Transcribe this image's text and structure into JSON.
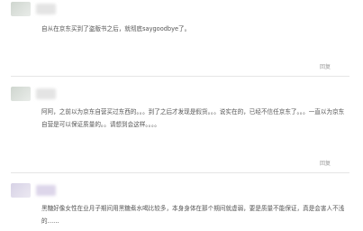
{
  "reviews": [
    {
      "text": "自从在京东买到了盗版书之后，就彻底saygoodbye了。",
      "reply_label": "回复"
    },
    {
      "text": "阿阿，之前以为京东自营买过东西的。。。到了之后才发现是假货。。。说实在的，已经不信任京东了。。。一直以为京东自营是可以保证质量的。。请想到会这样。。。。",
      "reply_label": "回复"
    },
    {
      "text": "黑糖好像女性在业月子期间用黑糖煮水喝比较多，本身身体在那个期间就虚弱，要是质量不能保证，真是会害人不浅的……",
      "reply_label": "回复"
    }
  ]
}
